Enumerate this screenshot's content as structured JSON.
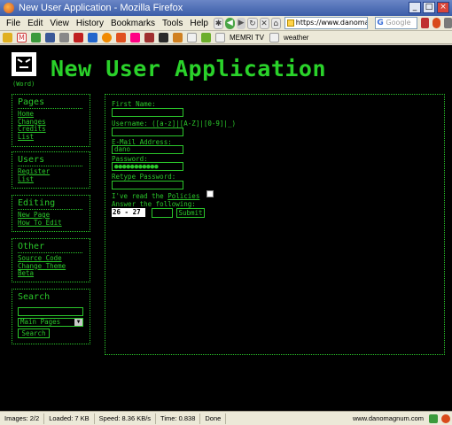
{
  "window": {
    "title": "New User Application - Mozilla Firefox",
    "controls": [
      "_",
      "□",
      "×"
    ]
  },
  "menu": {
    "items": [
      "File",
      "Edit",
      "View",
      "History",
      "Bookmarks",
      "Tools",
      "Help"
    ]
  },
  "toolbar": {
    "url": "https://www.danomagnum.com/w",
    "search_placeholder": "Google"
  },
  "bookmarks": {
    "items": [
      "MEMRI TV",
      "weather"
    ]
  },
  "page": {
    "logo_caption": "(Word)",
    "site_title": "New User Application",
    "sidebar": {
      "pages": {
        "heading": "Pages",
        "links": [
          "Home",
          "Changes",
          "Credits",
          "List"
        ]
      },
      "users": {
        "heading": "Users",
        "links": [
          "Register",
          "List"
        ]
      },
      "editing": {
        "heading": "Editing",
        "links": [
          "New Page",
          "How To Edit"
        ]
      },
      "other": {
        "heading": "Other",
        "links": [
          "Source Code",
          "Change Theme",
          "Beta"
        ]
      },
      "search": {
        "heading": "Search",
        "select_value": "Main Pages",
        "button_label": "Search"
      }
    },
    "form": {
      "first_name_label": "First Name:",
      "username_label": "Username: ([a-z]|[A-Z]|[0-9]|_)",
      "email_label": "E-Mail Address:",
      "email_value": "dano",
      "password_label": "Password:",
      "password_value": "●●●●●●●●●●●",
      "retype_label": "Retype Password:",
      "policies_prefix": "I've read the",
      "policies_link": "Policies",
      "answer_label": "Answer the following:",
      "captcha_question": "26 - 27 =",
      "submit_label": "Submit"
    }
  },
  "status": {
    "images": "Images: 2/2",
    "loaded": "Loaded: 7 KB",
    "speed": "Speed: 8.36 KB/s",
    "time": "Time: 0.838",
    "state": "Done",
    "host": "www.danomagnum.com"
  }
}
